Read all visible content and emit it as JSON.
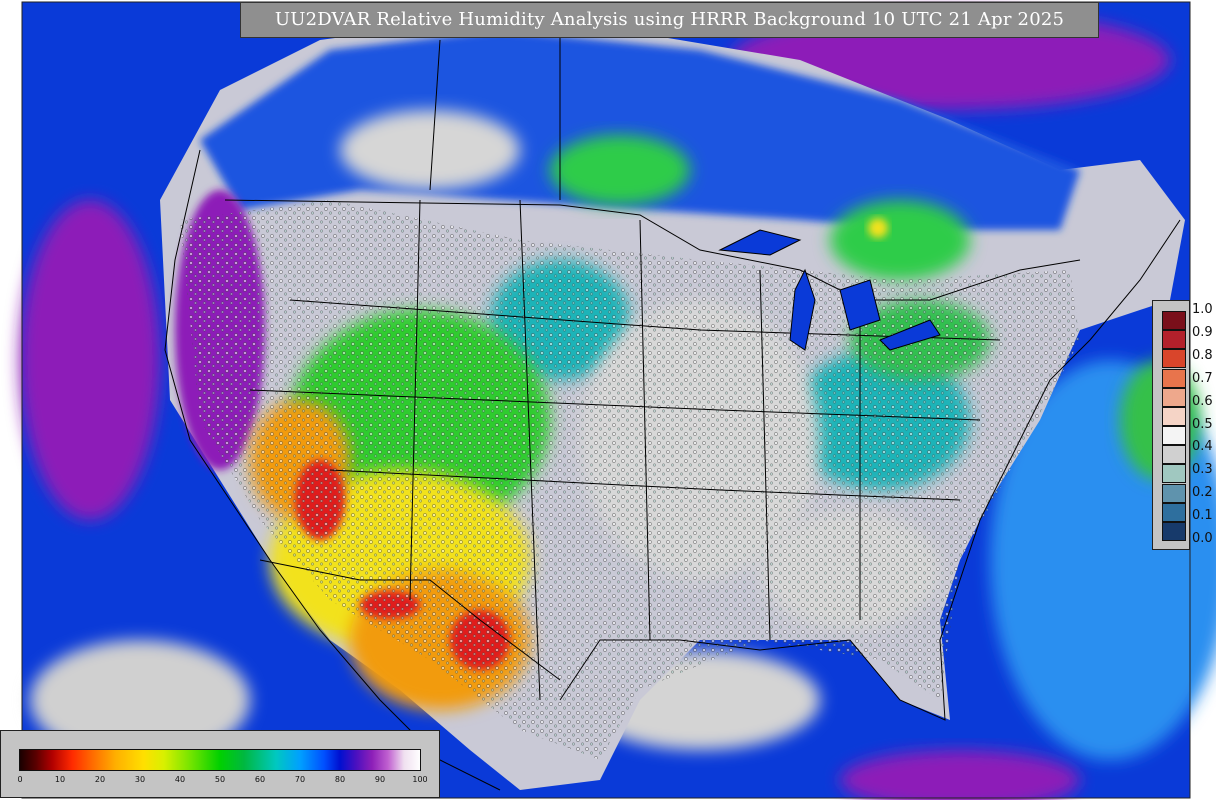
{
  "title": "UU2DVAR Relative Humidity Analysis using HRRR Background 10 UTC 21 Apr 2025",
  "ob_legend": {
    "labels": [
      "1.0",
      "0.9",
      "0.8",
      "0.7",
      "0.6",
      "0.5",
      "0.4",
      "0.3",
      "0.2",
      "0.1",
      "0.0"
    ],
    "colors": [
      "#7a0f1a",
      "#b3202b",
      "#d9452b",
      "#e8744c",
      "#eea88c",
      "#f5d4c6",
      "#f4f4f4",
      "#d0d0d0",
      "#a0c8c0",
      "#5f93ad",
      "#2e6f9e",
      "#173a6b"
    ]
  },
  "rh_legend": {
    "ticks": [
      "0",
      "10",
      "20",
      "30",
      "40",
      "50",
      "60",
      "70",
      "80",
      "90",
      "100"
    ]
  },
  "colors": {
    "ocean": "#0a3ad8",
    "ocean_light": "#2a8ff0",
    "purple": "#8d1fb8",
    "gray_land": "#d8d8d8",
    "green": "#2ecc2e",
    "yellow": "#f2e21c",
    "orange": "#f29b0f",
    "red": "#e01f1f",
    "cyan": "#1bc9c0"
  }
}
